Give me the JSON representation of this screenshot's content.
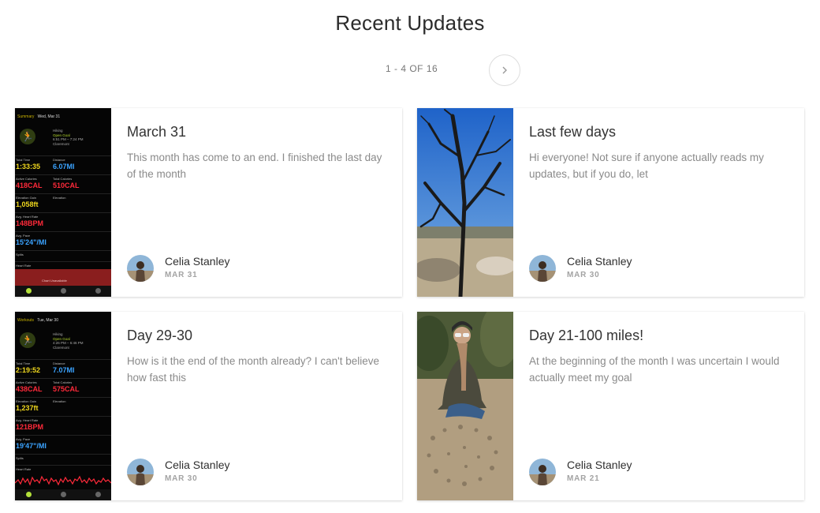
{
  "header": {
    "title": "Recent Updates"
  },
  "pagination": {
    "label": "1 - 4 OF 16"
  },
  "cards": [
    {
      "title": "March 31",
      "excerpt": "This month has come to an end. I finished the last day of the month",
      "author": "Celia Stanley",
      "date": "MAR 31",
      "thumb_kind": "watch-summary"
    },
    {
      "title": "Last few days",
      "excerpt": "Hi everyone! Not sure if anyone actually reads my updates, but if you do, let",
      "author": "Celia Stanley",
      "date": "MAR 30",
      "thumb_kind": "tree-photo"
    },
    {
      "title": "Day 29-30",
      "excerpt": "How is it the end of the month already? I can't believe how fast this",
      "author": "Celia Stanley",
      "date": "MAR 30",
      "thumb_kind": "watch-workouts"
    },
    {
      "title": "Day 21-100 miles!",
      "excerpt": "At the beginning of the month I was uncertain I would actually meet my goal",
      "author": "Celia Stanley",
      "date": "MAR 21",
      "thumb_kind": "person-photo"
    }
  ],
  "watch_summary": {
    "header_left": "Summary",
    "header_date": "Wed, Mar 31",
    "activity": "Hiking",
    "goal": "Open Goal",
    "time_range": "6:51 PM – 7:24 PM",
    "location": "Claremont",
    "total_time_label": "Total Time",
    "total_time": "1:33:35",
    "distance_label": "Distance",
    "distance": "6.07MI",
    "active_cal_label": "Active Calories",
    "active_cal": "418CAL",
    "total_cal_label": "Total Calories",
    "total_cal": "510CAL",
    "elev_gain_label": "Elevation Gain",
    "elev_gain": "1,058ft",
    "elev_label": "Elevation",
    "hr_label": "Avg. Heart Rate",
    "hr": "148BPM",
    "pace_label": "Avg. Pace",
    "pace": "15'24\"/MI",
    "splits_label": "Splits",
    "hr2_label": "Heart Rate",
    "chart_unavailable": "Chart Unavailable"
  },
  "watch_workouts": {
    "header_left": "Workouts",
    "header_date": "Tue, Mar 30",
    "activity": "Hiking",
    "goal": "Open Goal",
    "time_range": "4:26 PM – 6:46 PM",
    "location": "Claremont",
    "total_time_label": "Total Time",
    "total_time": "2:19:52",
    "distance_label": "Distance",
    "distance": "7.07MI",
    "active_cal_label": "Active Calories",
    "active_cal": "438CAL",
    "total_cal_label": "Total Calories",
    "total_cal": "575CAL",
    "elev_gain_label": "Elevation Gain",
    "elev_gain": "1,237ft",
    "elev_label": "Elevation",
    "hr_label": "Avg. Heart Rate",
    "hr": "121BPM",
    "pace_label": "Avg. Pace",
    "pace": "19'47\"/MI",
    "splits_label": "Splits",
    "hr2_label": "Heart Rate"
  }
}
